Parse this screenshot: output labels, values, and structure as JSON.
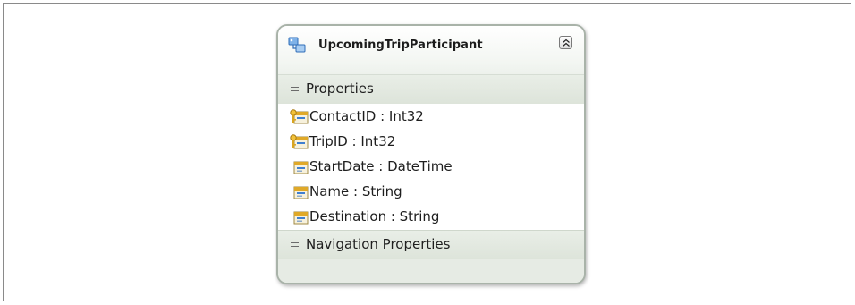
{
  "entity": {
    "name": "UpcomingTripParticipant",
    "sections": {
      "properties_label": "Properties",
      "navigation_label": "Navigation Properties"
    },
    "properties": [
      {
        "text": "ContactID : Int32",
        "key": true,
        "icon": "key-property-icon"
      },
      {
        "text": "TripID : Int32",
        "key": true,
        "icon": "key-property-icon"
      },
      {
        "text": "StartDate : DateTime",
        "key": false,
        "icon": "scalar-property-icon"
      },
      {
        "text": "Name : String",
        "key": false,
        "icon": "scalar-property-icon"
      },
      {
        "text": "Destination : String",
        "key": false,
        "icon": "scalar-property-icon"
      }
    ]
  },
  "colors": {
    "frame_border": "#8a8a8a",
    "entity_border": "#a9b3a9",
    "section_bg": "#e4e9e1",
    "icon_gold": "#e0a928",
    "icon_blue": "#3f7fd0"
  }
}
